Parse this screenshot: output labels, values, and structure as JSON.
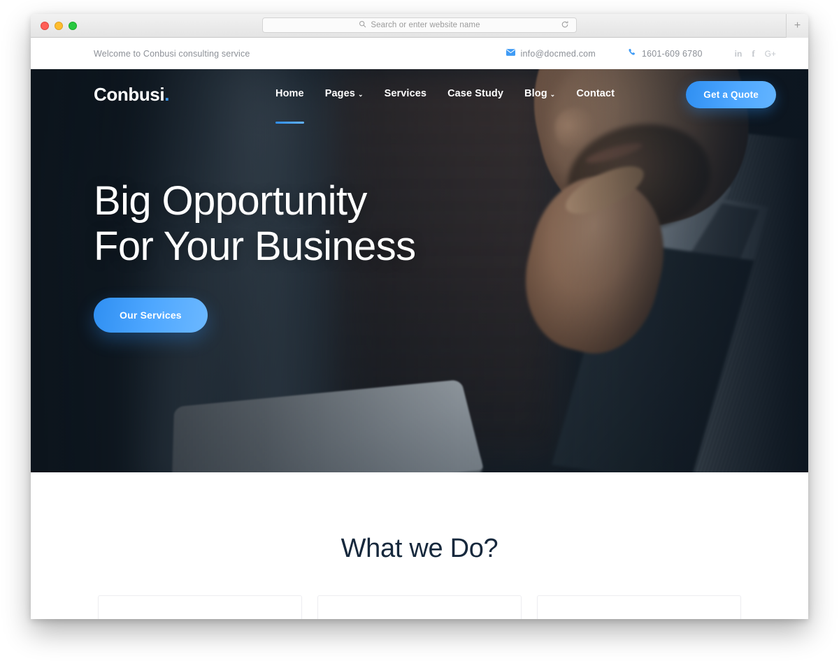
{
  "browser": {
    "search_placeholder": "Search or enter website name",
    "search_value": "",
    "search_icon": "search-icon",
    "reload_icon": "reload-icon",
    "new_tab_label": "+",
    "traffic_lights": [
      "close",
      "minimize",
      "zoom"
    ]
  },
  "topbar": {
    "welcome": "Welcome to Conbusi consulting service",
    "email": "info@docmed.com",
    "phone": "1601-609 6780",
    "email_icon": "mail-icon",
    "phone_icon": "phone-icon",
    "socials": [
      {
        "name": "linkedin-icon",
        "glyph": "in"
      },
      {
        "name": "facebook-icon",
        "glyph": "f"
      },
      {
        "name": "googleplus-icon",
        "glyph": "G+"
      }
    ]
  },
  "nav": {
    "logo": "Conbusi",
    "logo_dot": ".",
    "items": [
      {
        "label": "Home",
        "has_dropdown": false,
        "active": true
      },
      {
        "label": "Pages",
        "has_dropdown": true,
        "active": false
      },
      {
        "label": "Services",
        "has_dropdown": false,
        "active": false
      },
      {
        "label": "Case Study",
        "has_dropdown": false,
        "active": false
      },
      {
        "label": "Blog",
        "has_dropdown": true,
        "active": false
      },
      {
        "label": "Contact",
        "has_dropdown": false,
        "active": false
      }
    ],
    "cta_label": "Get a Quote",
    "caret_glyph": "⌄"
  },
  "hero": {
    "title_line1": "Big Opportunity",
    "title_line2": "For Your Business",
    "button_label": "Our Services"
  },
  "section": {
    "title": "What we Do?",
    "cards": [
      {
        "name": "service-card-1"
      },
      {
        "name": "service-card-2"
      },
      {
        "name": "service-card-3"
      }
    ]
  },
  "colors": {
    "accent_blue": "#3f9bf5",
    "accent_blue_light": "#63b4ff",
    "hero_dark": "#141e28",
    "heading_navy": "#16283c",
    "muted_text": "#8c9097"
  }
}
